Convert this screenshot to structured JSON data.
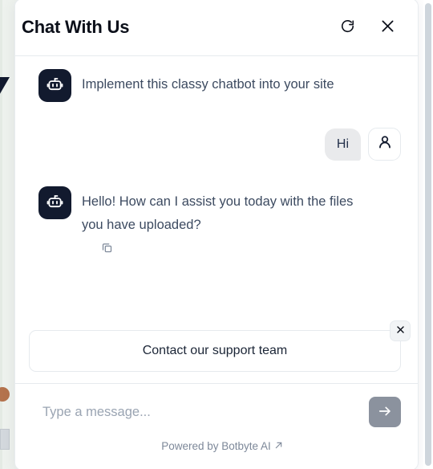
{
  "header": {
    "title": "Chat With Us",
    "refresh_icon": "refresh-icon",
    "close_icon": "close-icon"
  },
  "messages": [
    {
      "id": "msg-1",
      "sender": "bot",
      "avatar_icon": "robot-icon",
      "text": "Implement this classy chatbot into your site"
    },
    {
      "id": "msg-2",
      "sender": "user",
      "avatar_icon": "user-icon",
      "text": "Hi"
    },
    {
      "id": "msg-3",
      "sender": "bot",
      "avatar_icon": "robot-icon",
      "text": "Hello! How can I assist you today with the files you have uploaded?",
      "copy_icon": "copy-icon"
    }
  ],
  "suggestions": {
    "items": [
      {
        "label": "Contact our support team"
      }
    ],
    "dismiss_icon": "close-icon"
  },
  "composer": {
    "placeholder": "Type a message...",
    "value": "",
    "send_icon": "arrow-right-icon"
  },
  "footer": {
    "powered_by": "Powered by Botbyte AI",
    "external_link_icon": "external-link-arrow-icon"
  },
  "colors": {
    "bot_avatar_bg": "#121a2e",
    "user_bubble_bg": "#e9eaec",
    "send_button_bg": "#8b929e",
    "body_text": "#3c4a60",
    "title_text": "#0b0f19",
    "border": "#e6eaee"
  }
}
